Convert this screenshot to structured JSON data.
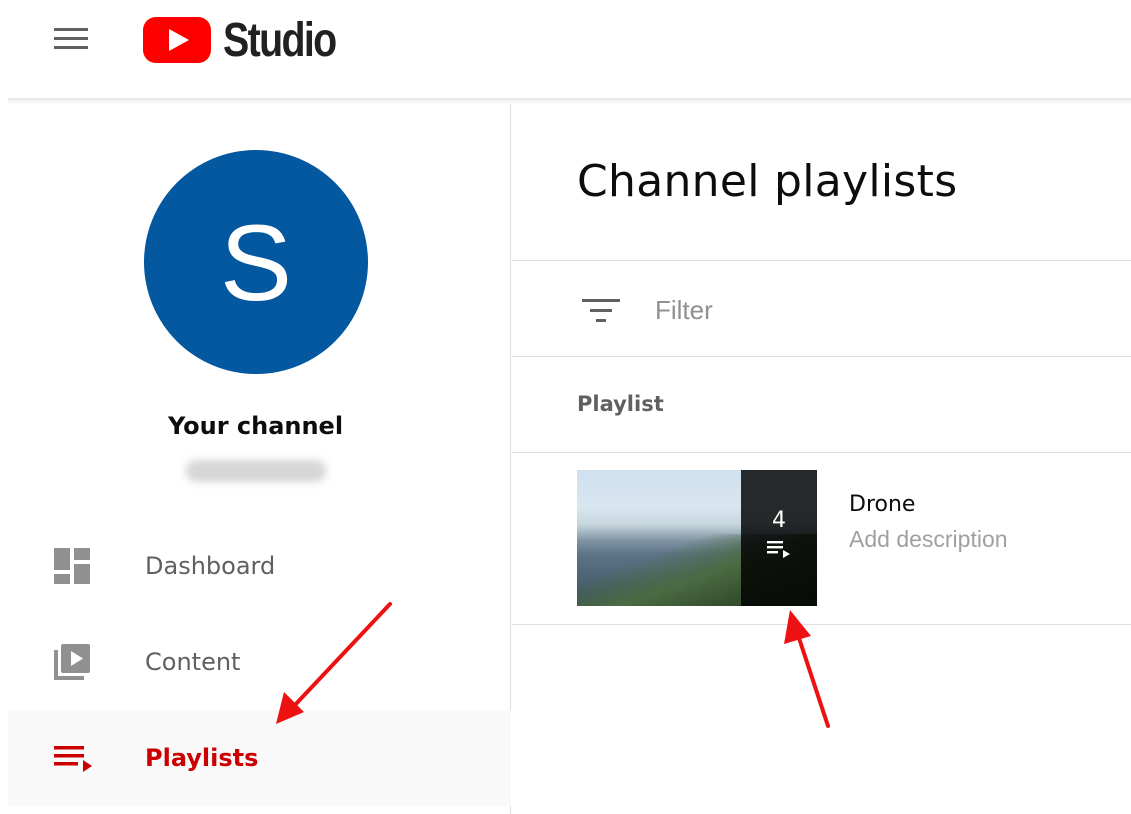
{
  "app": {
    "logo_text": "Studio",
    "brand_color": "#ff0000"
  },
  "header": {
    "menu_icon": "hamburger-menu-icon",
    "logo_icon": "youtube-play-icon"
  },
  "sidebar": {
    "avatar_letter": "S",
    "avatar_color": "#04589f",
    "channel_title": "Your channel",
    "items": [
      {
        "label": "Dashboard",
        "icon": "dashboard-icon",
        "active": false
      },
      {
        "label": "Content",
        "icon": "content-icon",
        "active": false
      },
      {
        "label": "Playlists",
        "icon": "playlists-icon",
        "active": true
      }
    ],
    "active_color": "#cc0000"
  },
  "main": {
    "title": "Channel playlists",
    "filter": {
      "placeholder": "Filter",
      "value": "",
      "icon": "filter-icon"
    },
    "columns": [
      "Playlist"
    ],
    "playlists": [
      {
        "title": "Drone",
        "description": "Add description",
        "video_count": "4",
        "icon": "playlist-play-icon"
      }
    ]
  },
  "annotations": {
    "arrow_color": "#ee1111"
  }
}
